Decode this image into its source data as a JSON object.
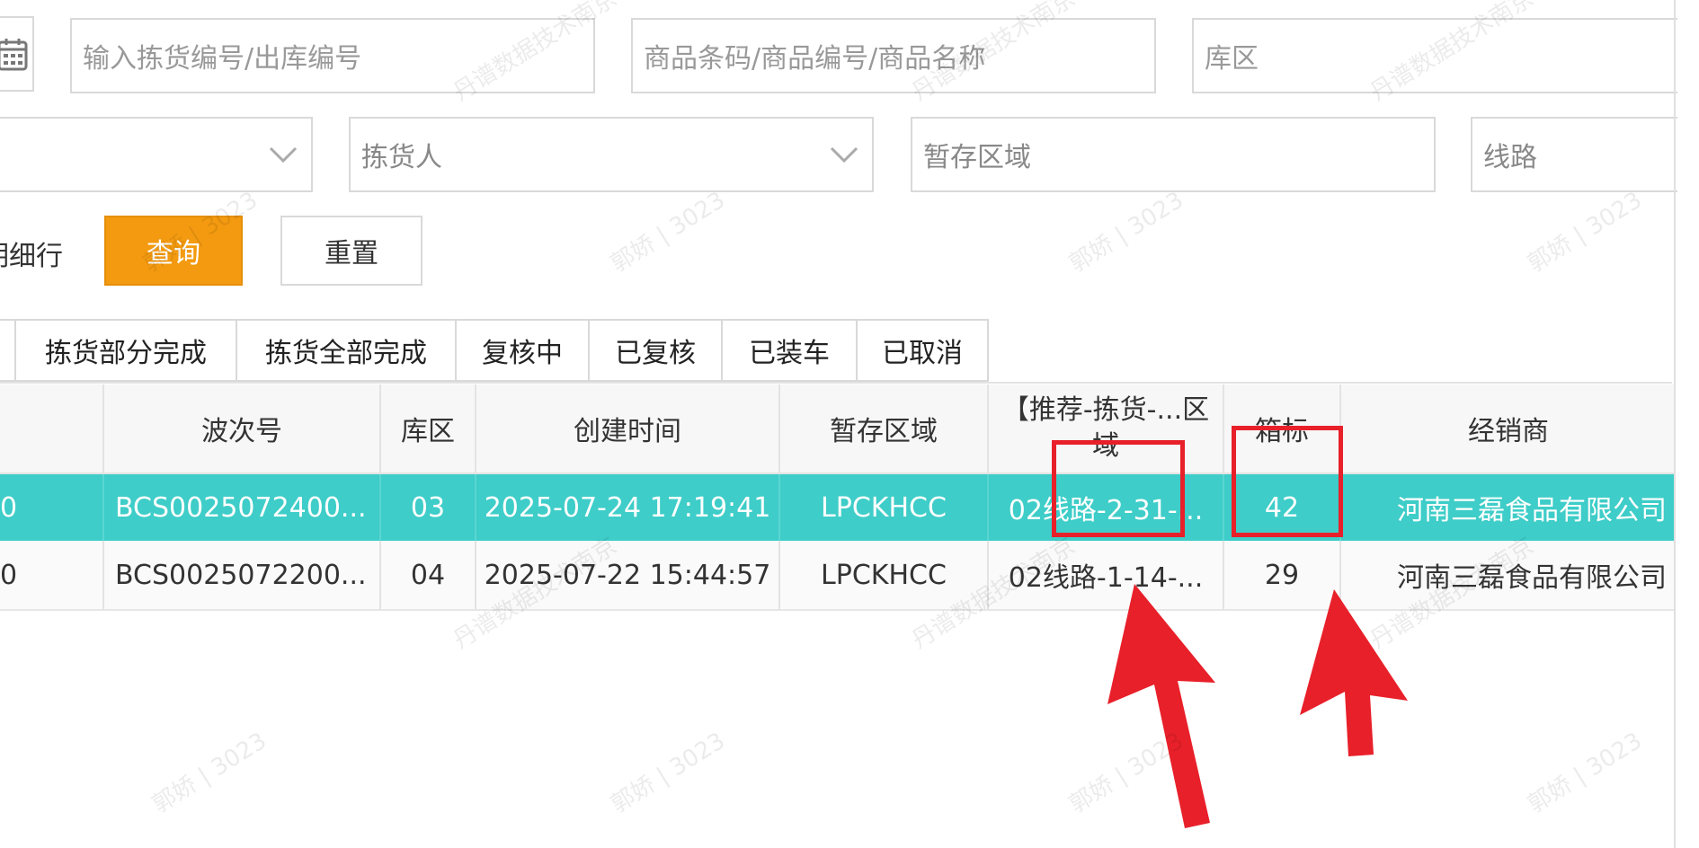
{
  "filters": {
    "pick_no_placeholder": "输入拣货编号/出库编号",
    "product_placeholder": "商品条码/商品编号/商品名称",
    "warehouse_area_placeholder": "库区",
    "picker_placeholder": "拣货人",
    "staging_area_placeholder": "暂存区域",
    "route_placeholder": "线路",
    "detail_label": "明细行",
    "query_label": "查询",
    "reset_label": "重置"
  },
  "tabs": [
    {
      "label": "拣货部分完成"
    },
    {
      "label": "拣货全部完成"
    },
    {
      "label": "复核中"
    },
    {
      "label": "已复核"
    },
    {
      "label": "已装车"
    },
    {
      "label": "已取消"
    }
  ],
  "table": {
    "headers": [
      "波次号",
      "库区",
      "创建时间",
      "暂存区域",
      "【推荐-拣货-...区域",
      "箱标",
      "经销商"
    ],
    "rows": [
      {
        "lead": "0",
        "wave": "BCS0025072400...",
        "area": "03",
        "created": "2025-07-24 17:19:41",
        "staging": "LPCKHCC",
        "recommend": "02线路-2-31-...",
        "box": "42",
        "dealer": "河南三磊食品有限公司"
      },
      {
        "lead": "0",
        "wave": "BCS0025072200...",
        "area": "04",
        "created": "2025-07-22 15:44:57",
        "staging": "LPCKHCC",
        "recommend": "02线路-1-14-...",
        "box": "29",
        "dealer": "河南三磊食品有限公司"
      }
    ]
  },
  "watermarks": [
    "郭娇 | 3023",
    "丹谱数据技术南京"
  ],
  "colors": {
    "accent_orange": "#f39a10",
    "selected_row": "#3ecdc8",
    "annotation_red": "#e8202a"
  }
}
